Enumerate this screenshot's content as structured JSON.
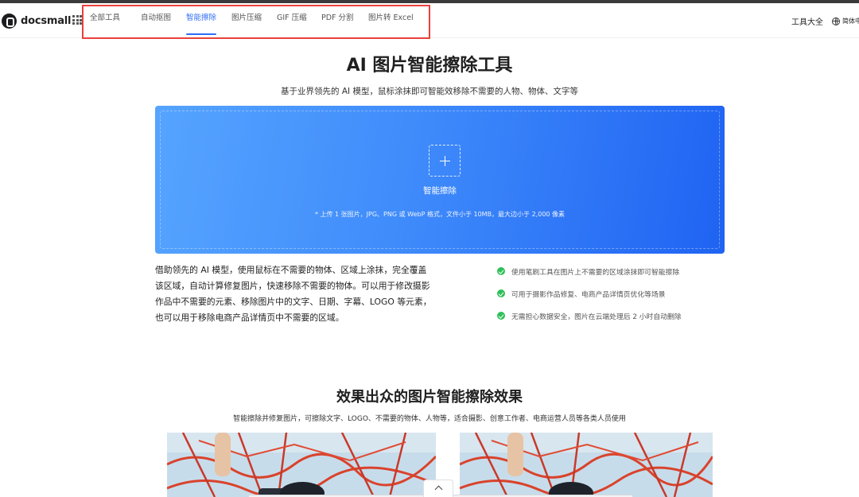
{
  "header": {
    "logo_text": "docsmall",
    "nav": [
      {
        "label": "全部工具",
        "active": false
      },
      {
        "label": "自动抠图",
        "active": false
      },
      {
        "label": "智能擦除",
        "active": true
      },
      {
        "label": "图片压缩",
        "active": false
      },
      {
        "label": "GIF 压缩",
        "active": false
      },
      {
        "label": "PDF 分割",
        "active": false
      },
      {
        "label": "图片转 Excel",
        "active": false
      }
    ],
    "tools_link": "工具大全",
    "language": "简体中"
  },
  "hero": {
    "title": "AI 图片智能擦除工具",
    "subtitle": "基于业界领先的 AI 模型，鼠标涂抹即可智能效移除不需要的人物、物体、文字等"
  },
  "upload": {
    "label": "智能擦除",
    "hint": "* 上传 1 张图片，JPG、PNG 或 WebP 格式，文件小于 10MB，最大边小于 2,000 像素"
  },
  "description": "借助领先的 AI 模型，使用鼠标在不需要的物体、区域上涂抹，完全覆盖该区域，自动计算修复图片，快速移除不需要的物体。可以用于修改摄影作品中不需要的元素、移除图片中的文字、日期、字幕、LOGO 等元素，也可以用于移除电商产品详情页中不需要的区域。",
  "features": [
    "使用笔刷工具在图片上不需要的区域涂抹即可智能擦除",
    "可用于摄影作品修复、电商产品详情页优化等场景",
    "无需担心数据安全，图片在云端处理后 2 小时自动删除"
  ],
  "effects": {
    "title": "效果出众的图片智能擦除效果",
    "subtitle": "智能擦除并修复图片，可擦除文字、LOGO、不需要的物体、人物等，适合摄影、创意工作者、电商运营人员等各类人员使用"
  },
  "colors": {
    "accent": "#2f6df6",
    "highlight_box": "#e8413a",
    "check": "#2fc05a",
    "upload_gradient_start": "#56a4ff",
    "upload_gradient_end": "#1f63f2"
  }
}
